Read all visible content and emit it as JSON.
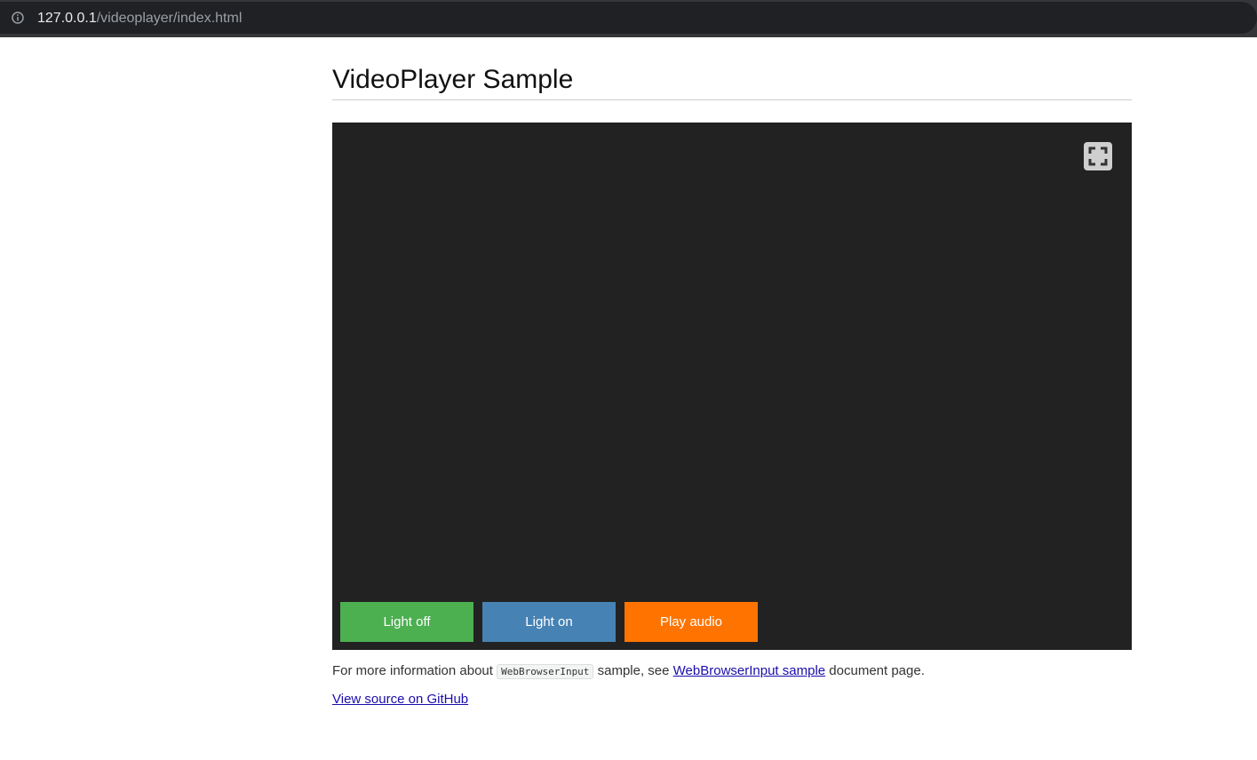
{
  "browser": {
    "url_host": "127.0.0.1",
    "url_path": "/videoplayer/index.html",
    "info_icon": "info-icon"
  },
  "page": {
    "title": "VideoPlayer Sample"
  },
  "player": {
    "fullscreen_icon": "fullscreen-icon",
    "buttons": [
      {
        "label": "Light off",
        "color": "#4caf50"
      },
      {
        "label": "Light on",
        "color": "#4682b4"
      },
      {
        "label": "Play audio",
        "color": "#ff7400"
      }
    ]
  },
  "info": {
    "prefix": "For more information about ",
    "code": "WebBrowserInput",
    "middle": " sample, see ",
    "link": "WebBrowserInput sample",
    "suffix": " document page."
  },
  "github": {
    "link": "View source on GitHub"
  }
}
